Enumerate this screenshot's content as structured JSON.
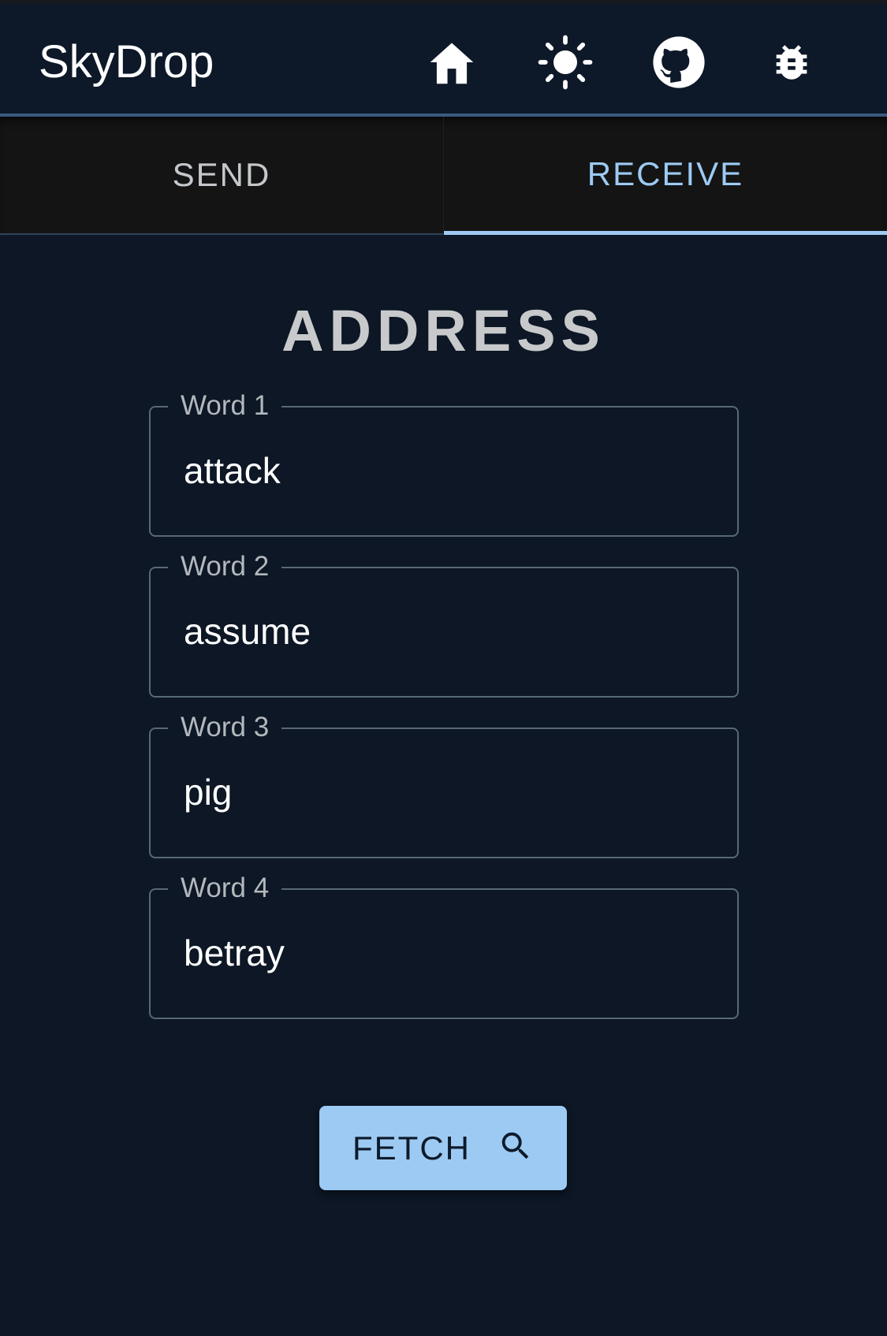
{
  "app": {
    "title": "SkyDrop"
  },
  "header_icons": [
    {
      "name": "home-icon"
    },
    {
      "name": "sun-icon"
    },
    {
      "name": "github-icon"
    },
    {
      "name": "bug-icon"
    }
  ],
  "tabs": [
    {
      "label": "SEND",
      "active": false
    },
    {
      "label": "RECEIVE",
      "active": true
    }
  ],
  "main": {
    "section_title": "ADDRESS",
    "fields": [
      {
        "label": "Word 1",
        "value": "attack"
      },
      {
        "label": "Word 2",
        "value": "assume"
      },
      {
        "label": "Word 3",
        "value": "pig"
      },
      {
        "label": "Word 4",
        "value": "betray"
      }
    ],
    "fetch_button": {
      "label": "FETCH",
      "icon": "search-icon"
    }
  },
  "colors": {
    "background": "#0d1725",
    "accent": "#9ccaf3",
    "tab_bar": "#141414"
  }
}
